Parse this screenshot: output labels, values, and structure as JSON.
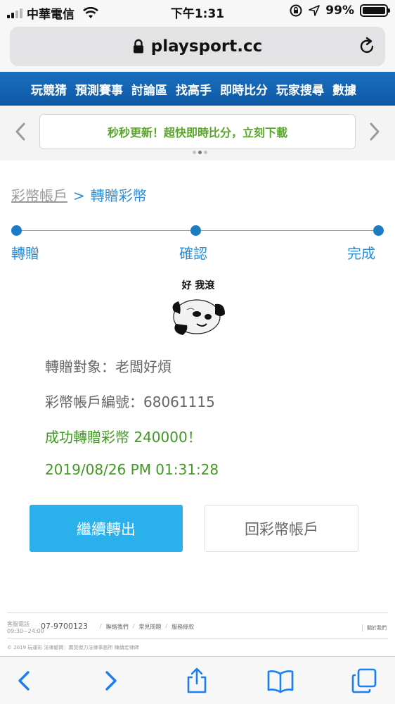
{
  "status_bar": {
    "carrier": "中華電信",
    "time": "下午1:31",
    "battery": "99%",
    "battery_level": 0.99
  },
  "browser": {
    "url": "playsport.cc"
  },
  "site_nav": {
    "items": [
      "玩競猜",
      "預測賽事",
      "討論區",
      "找高手",
      "即時比分",
      "玩家搜尋",
      "數據"
    ]
  },
  "banner": {
    "text": "秒秒更新！超快即時比分，立刻下載"
  },
  "breadcrumb": {
    "parent": "彩幣帳戶",
    "separator": ">",
    "current": "轉贈彩幣"
  },
  "steps": [
    "轉贈",
    "確認",
    "完成"
  ],
  "meme": {
    "caption": "好 我滾"
  },
  "result": {
    "recipient": "轉贈對象：老闆好煩",
    "account": "彩幣帳戶編號：68061115",
    "message": "成功轉贈彩幣 240000！",
    "timestamp": "2019/08/26 PM 01:31:28"
  },
  "actions": {
    "continue_label": "繼續轉出",
    "back_label": "回彩幣帳戶"
  },
  "footer": {
    "service_label": "客服電話",
    "service_hours": "09:30~24:00",
    "phone": "07-9700123",
    "links": [
      "聯絡我們",
      "常見問題",
      "服務條款"
    ],
    "about": "關於我們",
    "copyright": "© 2019 玩運彩 法律顧問：廣英傑力法律事務所 陳鎮宏律師"
  },
  "colors": {
    "accent": "#2ab1ec",
    "nav_blue": "#0d59a5",
    "step_blue": "#2a8ed6",
    "success_green": "#3f9a1f"
  }
}
